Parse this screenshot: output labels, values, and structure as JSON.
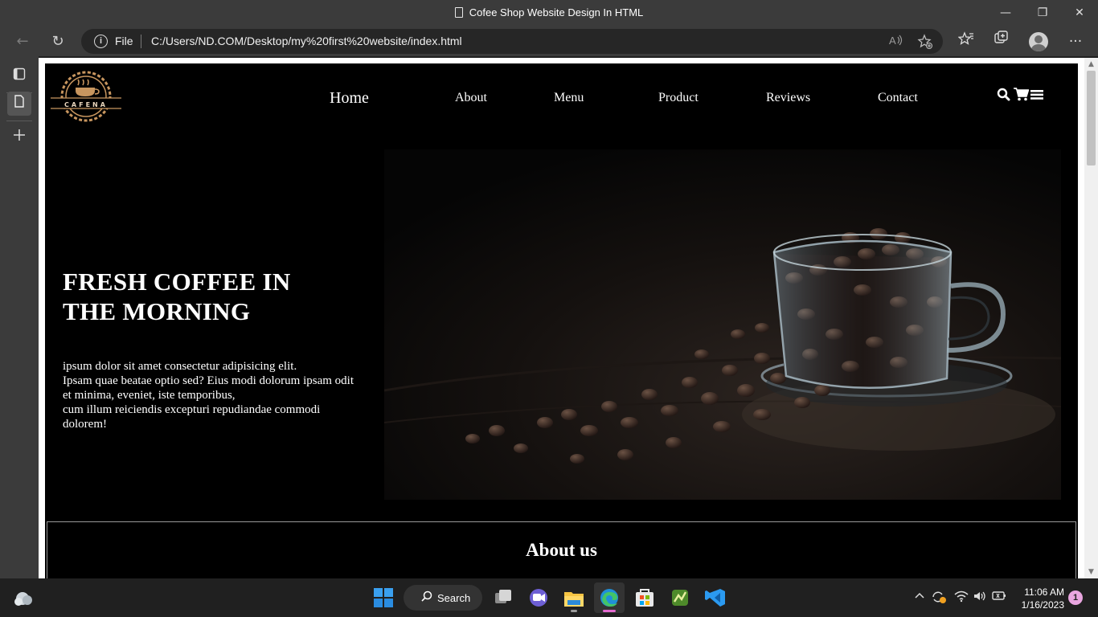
{
  "window": {
    "title": "Cofee Shop Website Design In HTML",
    "minimize_glyph": "—",
    "restore_glyph": "❐",
    "close_glyph": "✕"
  },
  "address_bar": {
    "scheme_label": "File",
    "url": "C:/Users/ND.COM/Desktop/my%20first%20website/index.html",
    "back_glyph": "←",
    "refresh_glyph": "↻",
    "more_glyph": "···"
  },
  "site": {
    "logo_text": "CAFENA",
    "nav": [
      {
        "label": "Home"
      },
      {
        "label": "About"
      },
      {
        "label": "Menu"
      },
      {
        "label": "Product"
      },
      {
        "label": "Reviews"
      },
      {
        "label": "Contact"
      }
    ],
    "hero": {
      "title": "FRESH COFFEE IN THE MORNING",
      "lines": [
        "ipsum dolor sit amet consectetur adipisicing elit.",
        "Ipsam quae beatae optio sed? Eius modi dolorum ipsam odit et minima, eveniet, iste temporibus,",
        "cum illum reiciendis excepturi repudiandae commodi dolorem!"
      ]
    },
    "about": {
      "heading": "About us"
    }
  },
  "taskbar": {
    "search_label": "Search",
    "time": "11:06 AM",
    "date": "1/16/2023",
    "notification_count": "1"
  },
  "colors": {
    "page_bg": "#000000",
    "chrome_bg": "#3b3b3b",
    "logo_tan": "#c8965f",
    "taskbar_bg": "#202020"
  }
}
